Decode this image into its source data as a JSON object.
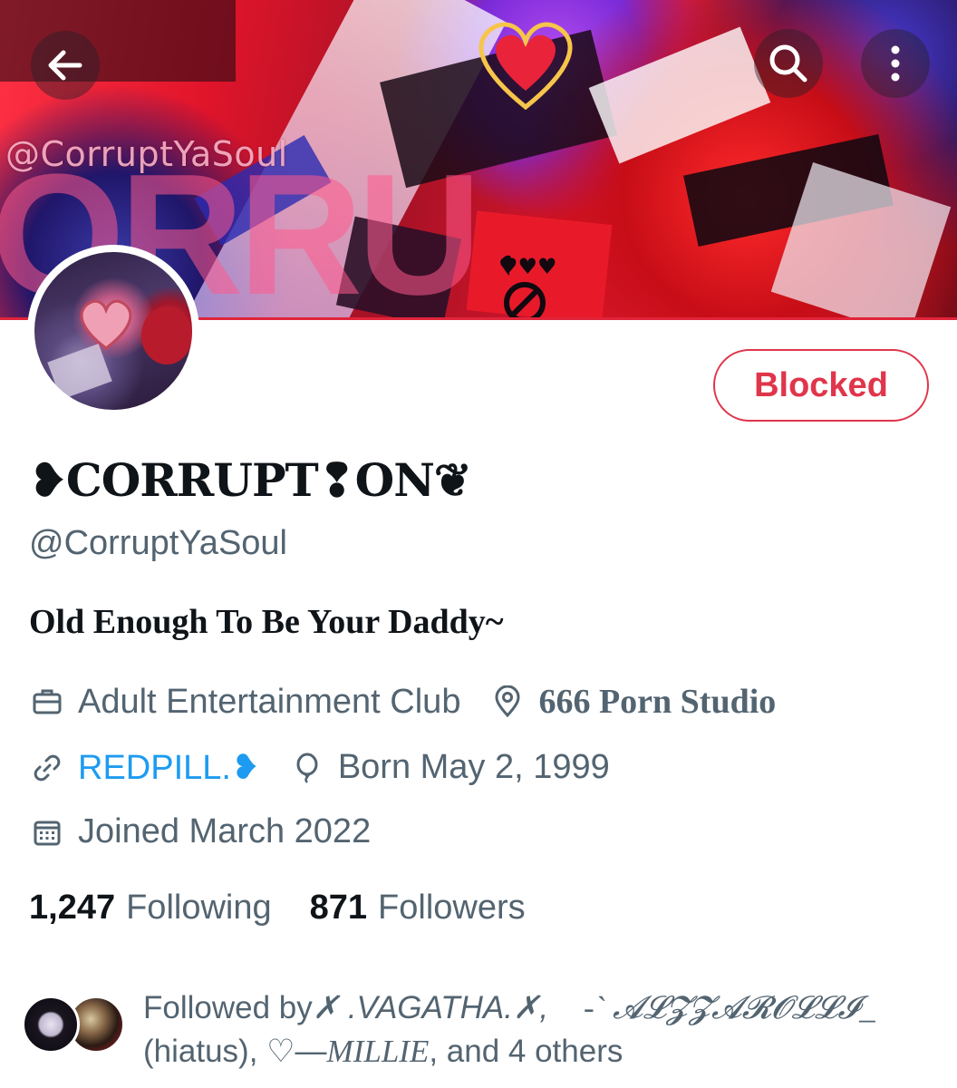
{
  "banner": {
    "watermark": "@CorruptYaSoul",
    "big_letters": "ORRU"
  },
  "nav": {
    "back_icon": "arrow-left-icon",
    "search_icon": "search-icon",
    "more_icon": "more-vertical-icon"
  },
  "profile": {
    "display_name": "❥CORRUPT❢ON❦",
    "handle": "@CorruptYaSoul",
    "bio": "Old Enough To Be Your Daddy~",
    "action_button": "Blocked",
    "category": "Adult Entertainment Club",
    "location": "666 Porn Studio",
    "website": "REDPILL.❥",
    "birthday": "Born May 2, 1999",
    "joined": "Joined March 2022"
  },
  "stats": {
    "following_count": "1,247",
    "following_label": "Following",
    "followers_count": "871",
    "followers_label": "Followers"
  },
  "followed_by": {
    "prefix": "Followed by",
    "name1": "✗ .VAGATHA.✗,",
    "name2": "-` 𝓐𝓛𝓩𝓩𝓐𝓡𝓞𝓛𝓛𝓘_",
    "name2_suffix": "(hiatus), ♡—",
    "name3": "MILLIE",
    "suffix": ", and 4 others"
  },
  "colors": {
    "blocked_red": "#e0354a",
    "link_blue": "#1d9bf0",
    "secondary_text": "#536471",
    "primary_text": "#0f1419"
  }
}
